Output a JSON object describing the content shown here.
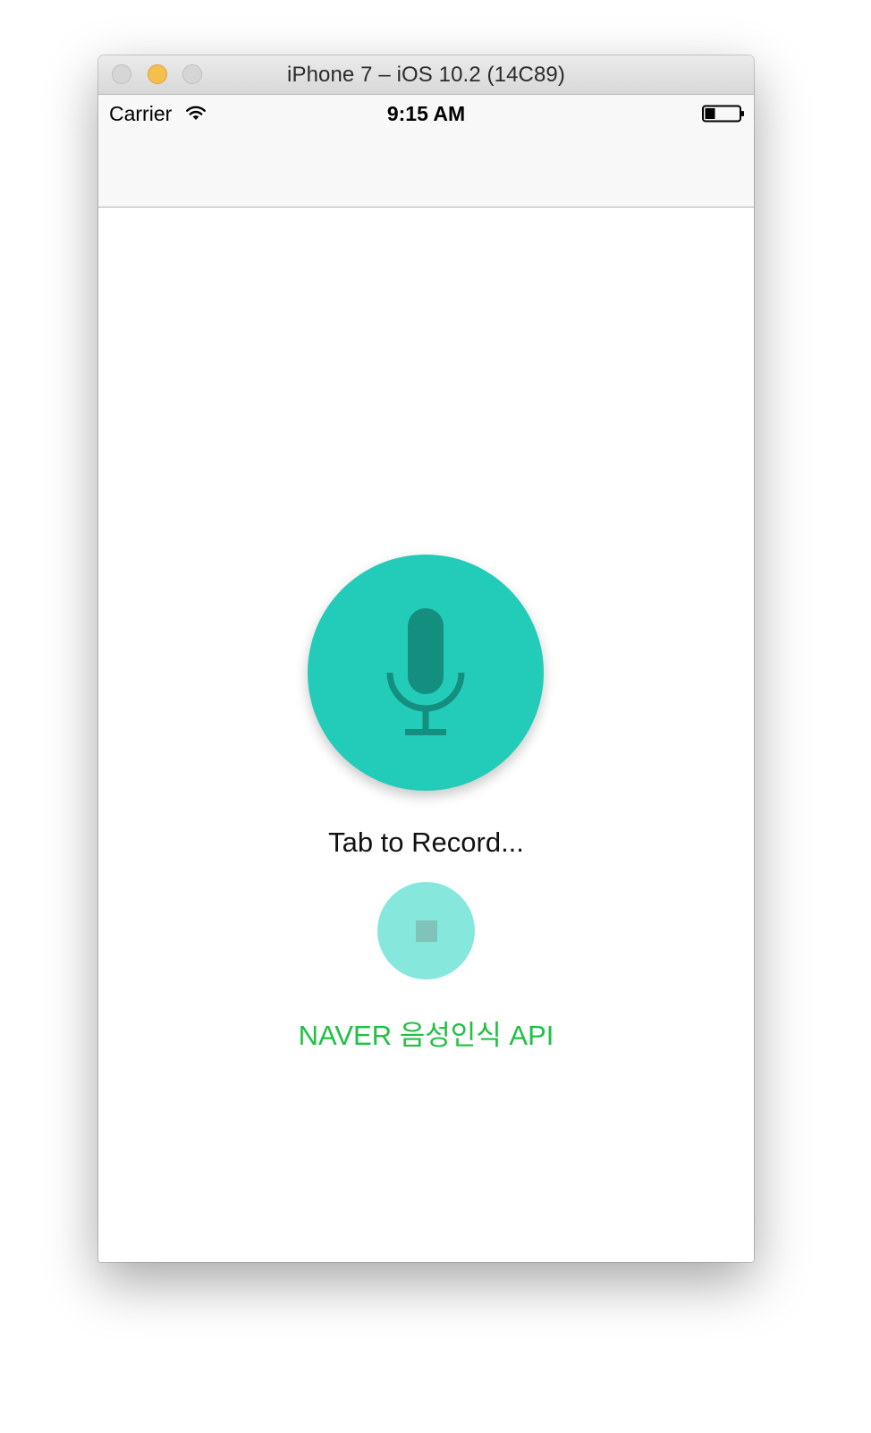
{
  "window": {
    "title": "iPhone 7 – iOS 10.2 (14C89)",
    "controls": [
      "close-icon",
      "minimize-icon",
      "zoom-icon"
    ]
  },
  "status_bar": {
    "carrier": "Carrier",
    "time": "9:15 AM",
    "icons": [
      "wifi-icon",
      "battery-icon"
    ]
  },
  "main": {
    "record_button_icon": "microphone-icon",
    "record_label": "Tab to Record...",
    "stop_button_icon": "stop-icon",
    "api_label": "NAVER 음성인식 API"
  },
  "colors": {
    "accent": "#23cbb9",
    "accent_dark": "#148e7e",
    "stop_button": "#86e7dd",
    "api_label": "#1ec143"
  }
}
